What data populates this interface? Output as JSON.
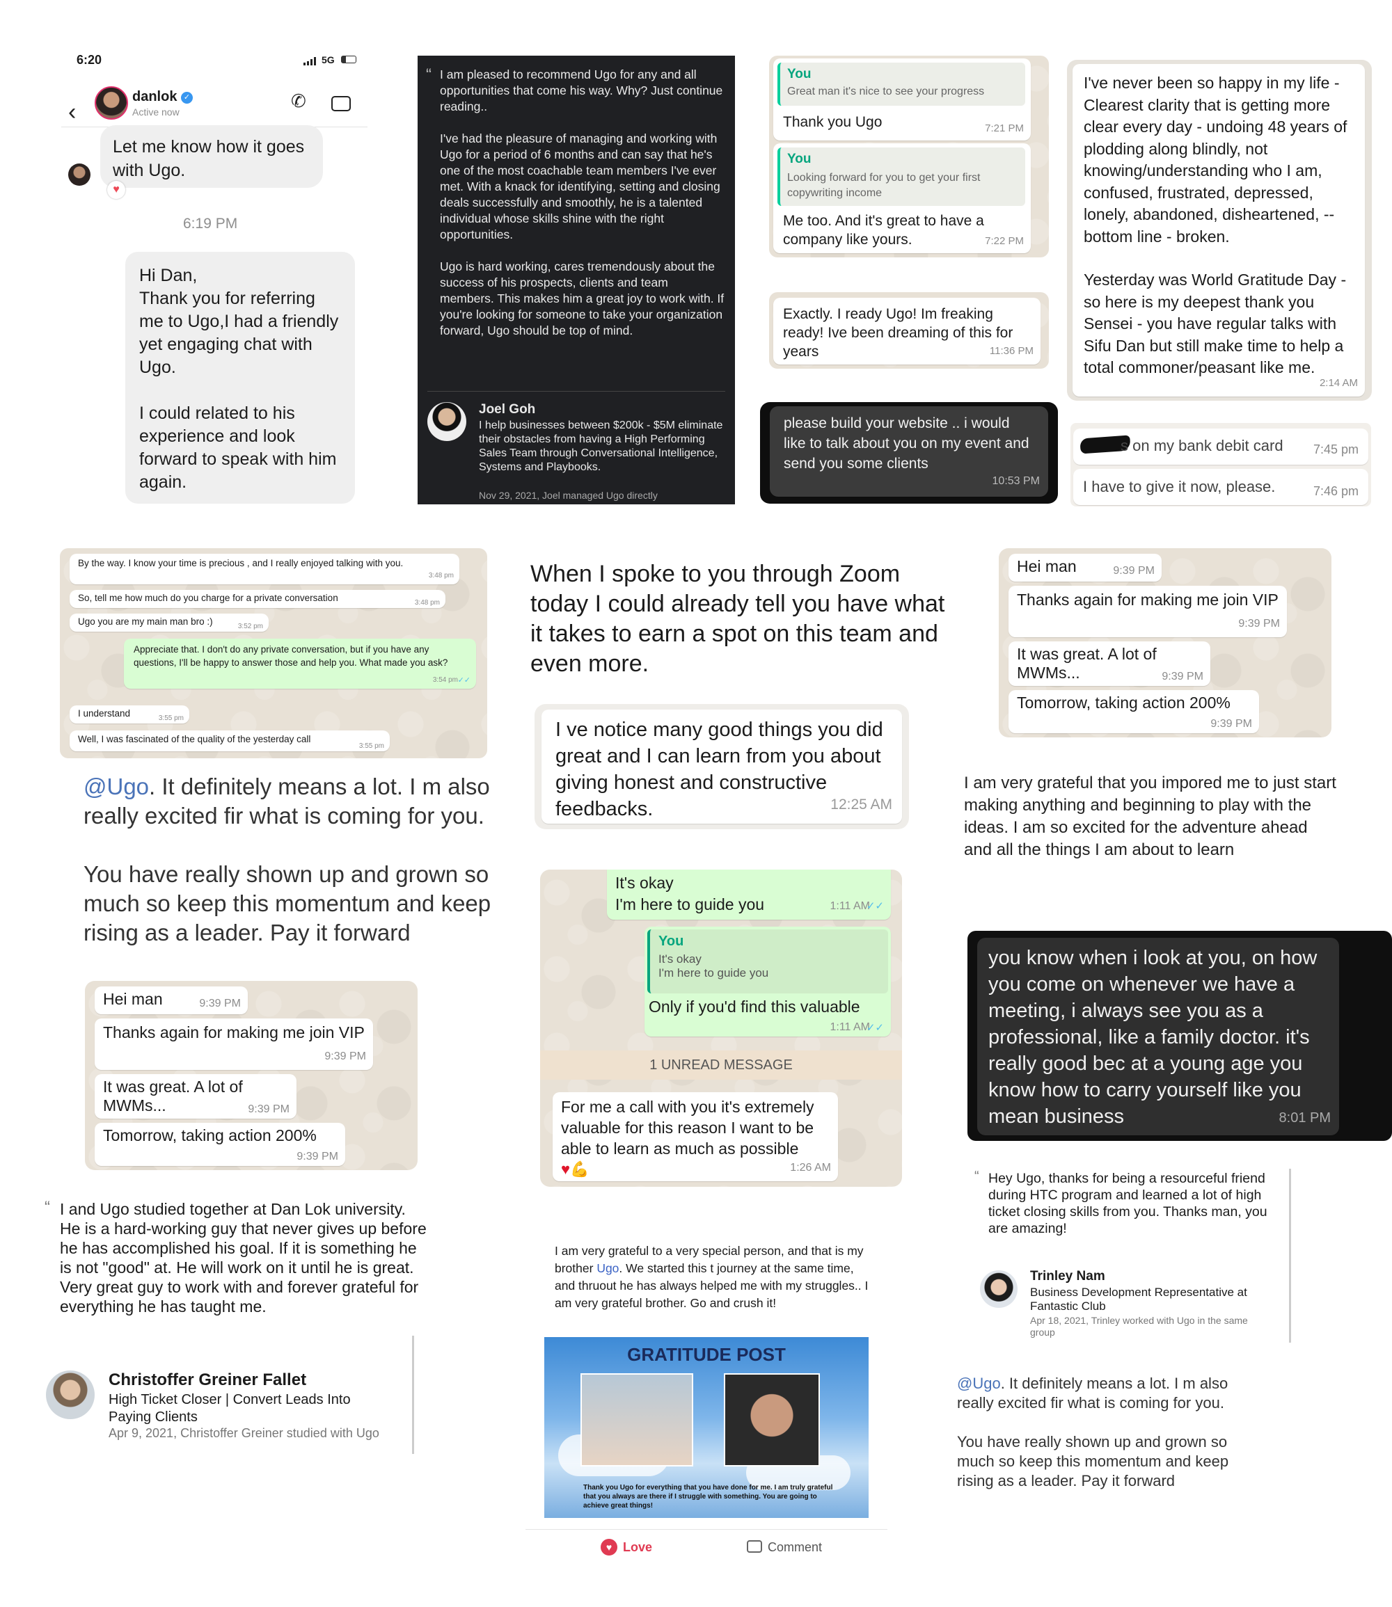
{
  "dm": {
    "time": "6:20",
    "net": "5G",
    "user": "danlok",
    "status": "Active now",
    "msg1": "Let me know how it goes with Ugo.",
    "react": "♥",
    "stamp": "6:19 PM",
    "reply": [
      "Hi Dan,",
      "Thank you for referring me to Ugo,I had a friendly yet engaging chat with Ugo.",
      "I could related to his experience and look forward to speak with him again."
    ]
  },
  "rec1": {
    "p1": "I am pleased to recommend Ugo for any and all opportunities that come his way. Why? Just continue reading..",
    "p2": "I've had the pleasure of managing and working with Ugo for a period of 6 months and can say that he's one of the most coachable team members I've ever met. With a knack for identifying, setting and closing deals successfully and smoothly, he is a talented individual whose skills shine with the right opportunities.",
    "p3": "Ugo is hard working, cares tremendously about the success of his prospects, clients and team members. This makes him a great joy to work with. If you're looking for someone to take your organization forward, Ugo should be top of mind.",
    "name": "Joel Goh",
    "title": "I help businesses between $200k - $5M eliminate their obstacles from having a High Performing Sales Team through Conversational Intelligence, Systems and Playbooks.",
    "date": "Nov 29, 2021, Joel managed Ugo directly"
  },
  "wa1": {
    "you": "You",
    "q1": "Great man it's nice to see your progress",
    "r1": "Thank you Ugo",
    "t1": "7:21 PM",
    "q2": "Looking forward for you to get your first copywriting income",
    "r2": "Me too. And it's great to have a company like yours.",
    "t2": "7:22 PM"
  },
  "wa2": {
    "msg": "Exactly. I ready Ugo! Im freaking ready! Ive been dreaming of this for years",
    "time": "11:36 PM"
  },
  "wa3": {
    "msg": "please build your website .. i would like to talk about you on my event and send you some clients",
    "time": "10:53 PM"
  },
  "long1": {
    "p1": "I've never been so happy in my life - Clearest clarity that is getting more clear every day - undoing 48 years of plodding along blindly, not knowing/understanding who I am, confused, frustrated, depressed, lonely, abandoned, disheartened, -- bottom line - broken.",
    "p2": "Yesterday was World Gratitude Day - so here is my  deepest thank you Sensei - you have regular talks with Sifu Dan but still make time to help a total commoner/peasant like me.",
    "time": "2:14 AM"
  },
  "bank": {
    "m1": "s on my bank debit card",
    "t1": "7:45 pm",
    "m2": "I have to give it now, please.",
    "t2": "7:46 pm"
  },
  "chat2": {
    "rows": [
      {
        "m": "By the way. I know your time is precious , and I really enjoyed talking with you.",
        "t": "3:48 pm"
      },
      {
        "m": "So, tell me how much do you charge for a private conversation",
        "t": "3:48 pm"
      },
      {
        "m": "Ugo you are my main man bro :)",
        "t": "3:52 pm"
      },
      {
        "m": "Appreciate that. I don't do any private conversation, but if you have any questions, I'll be happy to answer those and help you. What made you ask?",
        "t": "3:54 pm"
      },
      {
        "m": "I understand",
        "t": "3:55 pm"
      },
      {
        "m": "Well, I was fascinated of the quality of the yesterday call",
        "t": "3:55 pm"
      }
    ]
  },
  "mention1": {
    "at": "@Ugo",
    "l1": ". It definitely means a lot.  I m also really excited fir what is coming for you.",
    "l2": "You have really shown up and grown so much so keep this momentum and keep rising as a leader. Pay it forward"
  },
  "zoom": {
    "text": "When I spoke to you through Zoom today I could already tell you have what it takes to earn a spot on this team and even more."
  },
  "notice": {
    "msg": "I ve notice many good things you did great and I can learn from you about giving honest and constructive feedbacks.",
    "time": "12:25 AM"
  },
  "vip": {
    "rows": [
      {
        "m": "Hei man",
        "t": "9:39 PM"
      },
      {
        "m": "Thanks again for making me join VIP",
        "t": "9:39 PM"
      },
      {
        "m": "It was great. A lot of MWMs...",
        "t": "9:39 PM"
      },
      {
        "m": "Tomorrow, taking action 200%",
        "t": "9:39 PM"
      }
    ]
  },
  "grateful": {
    "text": "I am very grateful that you impored me to just start making anything and beginning to play with the ideas.  I am so excited for the adventure ahead",
    "text2": "and all the things I am about to learn"
  },
  "guide": {
    "m1a": "It's okay",
    "m1b": "I'm here to guide you",
    "t1": "1:11 AM",
    "you": "You",
    "qa": "It's okay",
    "qb": "I'm here to guide you",
    "m2": "Only if you'd find this valuable",
    "t2": "1:11 AM",
    "unread": "1 UNREAD MESSAGE",
    "m3": "For me a call with you it's extremely valuable for this reason I want to be able to learn as much as possible",
    "emoji": "♥💪",
    "t3": "1:26 AM"
  },
  "doctor": {
    "msg": "you know when i look at you, on how you come on whenever we have a meeting, i always see you as a professional, like a family doctor. it's really good bec at a young age you know how to carry yourself like you mean business",
    "time": "8:01 PM"
  },
  "rec2": {
    "text": "I and Ugo studied together at Dan Lok university. He is a hard-working guy that never gives up before he has accomplished his goal. If it is something he is not \"good\" at. He will work on it until he is great. Very great guy to work with and forever grateful for everything he has taught me.",
    "name": "Christoffer Greiner Fallet",
    "title": "High Ticket Closer | Convert Leads Into Paying Clients",
    "date": "Apr 9, 2021, Christoffer Greiner studied with Ugo"
  },
  "post": {
    "pre": "I am very grateful to a very special person, and that is my brother ",
    "ugo": "Ugo",
    "post": ". We started this t journey at the same time, and thruout he has always helped me with my struggles.. I am very grateful brother. Go and crush it!",
    "banner": "GRATITUDE POST",
    "caption": "Thank you Ugo for everything that you have done for me. I am truly grateful that you always are there if I struggle with something. You are going to achieve great things!",
    "love": "Love",
    "comment": "Comment"
  },
  "rec3": {
    "text": "Hey Ugo, thanks for being a resourceful friend during HTC program and learned a lot of high ticket closing skills from you. Thanks man, you are amazing!",
    "name": "Trinley Nam",
    "title": "Business Development Representative at Fantastic Club",
    "date": "Apr 18, 2021, Trinley worked with Ugo in the same group"
  },
  "mention2": {
    "at": "@Ugo",
    "l1": ". It definitely means a lot.  I m also really excited fir what is coming for you.",
    "l2": "You have really shown up and grown so much so keep this momentum and keep rising as a leader. Pay it forward"
  }
}
